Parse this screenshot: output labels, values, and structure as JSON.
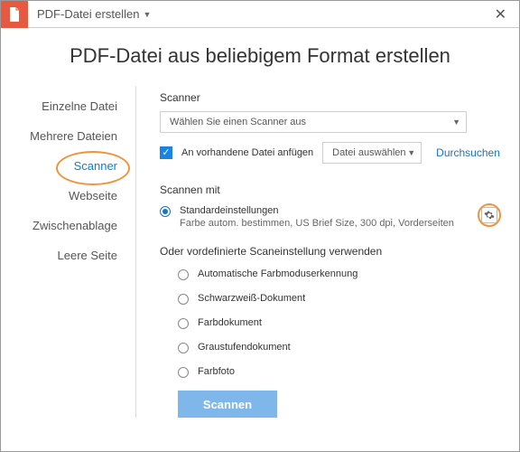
{
  "titlebar": {
    "title": "PDF-Datei erstellen"
  },
  "heading": "PDF-Datei aus beliebigem Format erstellen",
  "sidebar": {
    "items": [
      {
        "label": "Einzelne Datei"
      },
      {
        "label": "Mehrere Dateien"
      },
      {
        "label": "Scanner"
      },
      {
        "label": "Webseite"
      },
      {
        "label": "Zwischenablage"
      },
      {
        "label": "Leere Seite"
      }
    ],
    "active_index": 2
  },
  "scanner": {
    "section_label": "Scanner",
    "select_placeholder": "Wählen Sie einen Scanner aus",
    "append_checked": true,
    "append_label": "An vorhandene Datei anfügen",
    "file_select_label": "Datei auswählen",
    "browse_link": "Durchsuchen"
  },
  "scan_with": {
    "label": "Scannen mit",
    "default_option": "Standardeinstellungen",
    "default_sub": "Farbe autom. bestimmen, US Brief Size, 300 dpi, Vorderseiten",
    "or_label": "Oder vordefinierte Scaneinstellung verwenden",
    "presets": [
      "Automatische Farbmoduserkennung",
      "Schwarzweiß-Dokument",
      "Farbdokument",
      "Graustufendokument",
      "Farbfoto"
    ]
  },
  "scan_button": "Scannen"
}
